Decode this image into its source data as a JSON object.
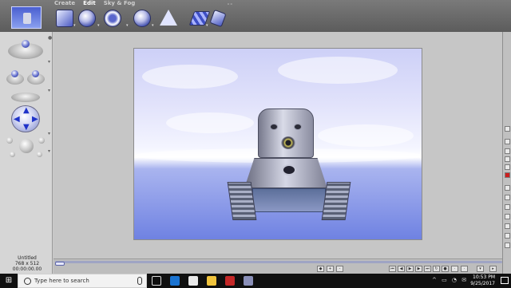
{
  "menus": [
    "Create",
    "Edit",
    "Sky & Fog"
  ],
  "active_menu": "Edit",
  "toolbar_icons": [
    "thumbnail-icon",
    "cube-icon",
    "lathe-icon",
    "torus-icon",
    "extrude-icon",
    "pyramid-icon",
    "plane-icon",
    "render-icon"
  ],
  "left_panel_icons": [
    "move-xz-icon",
    "rotate-icon",
    "move-arrows-icon",
    "zoom-spheres-icon"
  ],
  "document": {
    "name": "Untitled",
    "size": "768 x 512",
    "time": "00:00:00.00"
  },
  "colors": {
    "accent": "#1f33c9",
    "sky_top": "#cdd0f7",
    "ground": "#6f82e2"
  },
  "taskbar": {
    "search_placeholder": "Type here to search",
    "time": "10:53 PM",
    "date": "9/25/2017"
  }
}
